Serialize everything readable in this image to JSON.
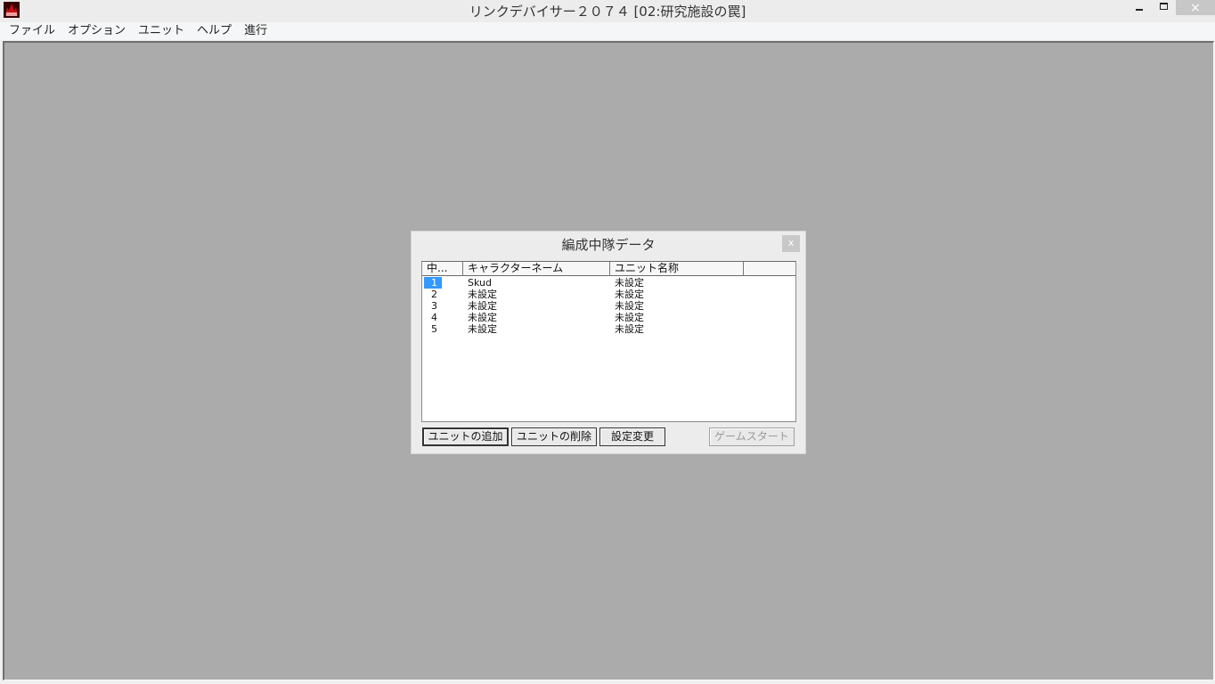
{
  "window": {
    "title": "リンクデバイサー２０７４ [02:研究施設の罠]",
    "icon": "app-icon",
    "controls": {
      "close": "×"
    }
  },
  "menu": {
    "items": [
      "ファイル",
      "オプション",
      "ユニット",
      "ヘルプ",
      "進行"
    ]
  },
  "dialog": {
    "title": "編成中隊データ",
    "close_label": "x",
    "columns": [
      "中...",
      "キャラクターネーム",
      "ユニット名称",
      ""
    ],
    "rows": [
      {
        "no": "1",
        "character": "Skud",
        "unit": "未設定",
        "selected": true
      },
      {
        "no": "2",
        "character": "未設定",
        "unit": "未設定",
        "selected": false
      },
      {
        "no": "3",
        "character": "未設定",
        "unit": "未設定",
        "selected": false
      },
      {
        "no": "4",
        "character": "未設定",
        "unit": "未設定",
        "selected": false
      },
      {
        "no": "5",
        "character": "未設定",
        "unit": "未設定",
        "selected": false
      }
    ],
    "buttons": {
      "add": "ユニットの追加",
      "delete": "ユニットの削除",
      "settings": "設定変更",
      "start": "ゲームスタート"
    }
  }
}
